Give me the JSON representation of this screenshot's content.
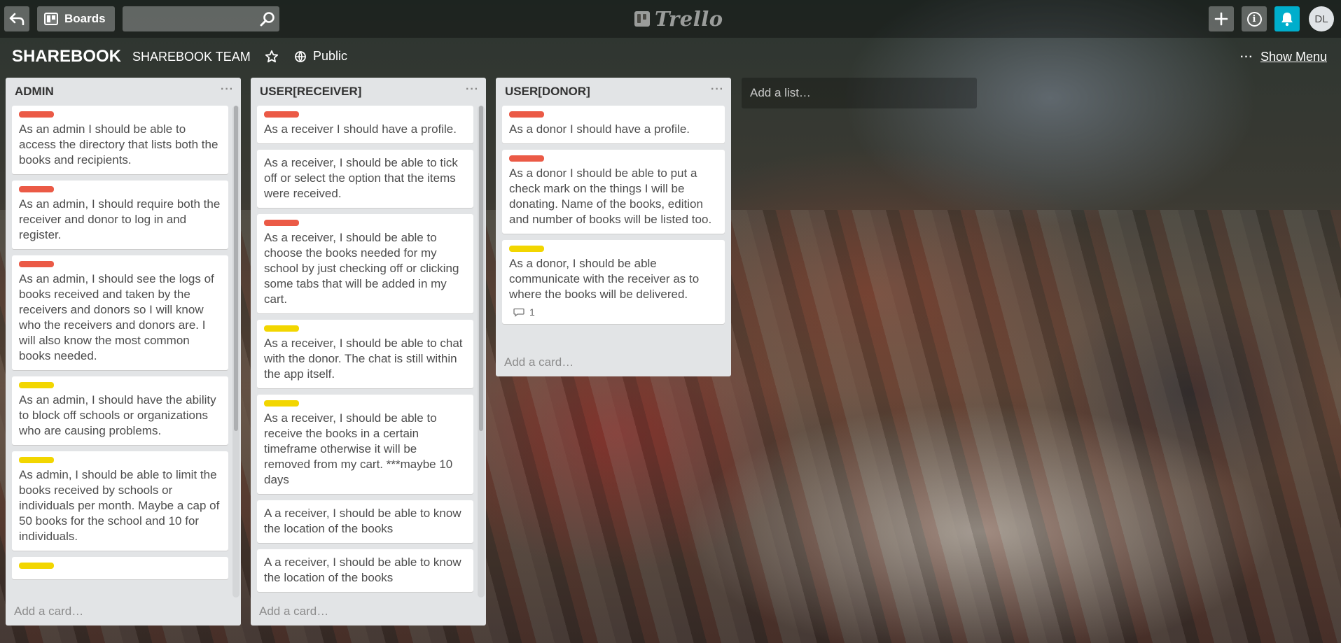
{
  "header": {
    "boards_label": "Boards",
    "search_value": "",
    "logo_text": "Trello",
    "avatar_initials": "DL"
  },
  "board": {
    "title": "SHAREBOOK",
    "team": "SHAREBOOK TEAM",
    "visibility": "Public",
    "show_menu": "Show Menu",
    "more_glyph": "···"
  },
  "colors": {
    "label_red": "#eb5a46",
    "label_yellow": "#f2d600",
    "notification_accent": "#00aecc",
    "list_bg": "#e2e4e6"
  },
  "lists": [
    {
      "title": "ADMIN",
      "menu": "···",
      "add_card": "Add a card…",
      "cards": [
        {
          "label": "red",
          "text": "As an admin I should be able to access the directory that lists both the books and recipients."
        },
        {
          "label": "red",
          "text": "As an admin, I should require both the receiver and donor to log in and register."
        },
        {
          "label": "red",
          "text": "As an admin, I should see the logs of books received and taken by the receivers and donors so I will know who the receivers and donors are. I will also know the most common books needed."
        },
        {
          "label": "yellow",
          "text": "As an admin, I should have the ability to block off schools or organizations who are causing problems."
        },
        {
          "label": "yellow",
          "text": "As admin, I should be able to limit the books received by schools or individuals per month. Maybe a cap of 50 books for the school and 10 for individuals."
        },
        {
          "label": "yellow",
          "text": ""
        }
      ]
    },
    {
      "title": "USER[RECEIVER]",
      "menu": "···",
      "add_card": "Add a card…",
      "cards": [
        {
          "label": "red",
          "text": "As a receiver I should have a profile."
        },
        {
          "label": "",
          "text": "As a receiver, I should be able to tick off or select the option that the items were received."
        },
        {
          "label": "red",
          "text": "As a receiver, I should be able to choose the books needed for my school by just checking off or clicking some tabs that will be added in my cart."
        },
        {
          "label": "yellow",
          "text": "As a receiver, I should be able to chat with the donor. The chat is still within the app itself."
        },
        {
          "label": "yellow",
          "text": "As a receiver, I should be able to receive the books in a certain timeframe otherwise it will be removed from my cart. ***maybe 10 days"
        },
        {
          "label": "",
          "text": "A a receiver, I should be able to know the location of the books"
        },
        {
          "label": "",
          "text": "A a receiver, I should be able to know the location of the books"
        }
      ]
    },
    {
      "title": "USER[DONOR]",
      "menu": "···",
      "add_card": "Add a card…",
      "cards": [
        {
          "label": "red",
          "text": "As a donor I should have a profile."
        },
        {
          "label": "red",
          "text": "As a donor I should be able to put a check mark on the things I will be donating. Name of the books, edition and number of books will be listed too."
        },
        {
          "label": "yellow",
          "text": "As a donor, I should be able communicate with the receiver as to where the books will be delivered.",
          "comments": "1"
        }
      ]
    }
  ],
  "add_list": "Add a list…"
}
